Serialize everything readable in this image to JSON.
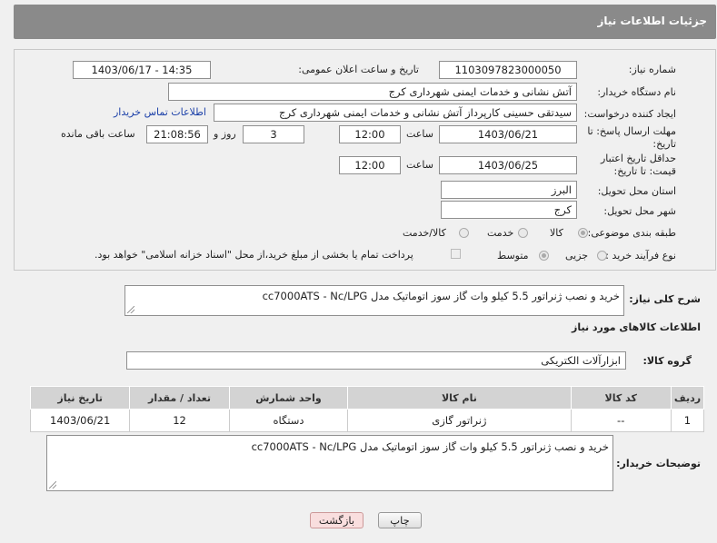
{
  "header": {
    "title": "جزئیات اطلاعات نیاز"
  },
  "form": {
    "need_number_label": "شماره نیاز:",
    "need_number": "1103097823000050",
    "announce_label": "تاریخ و ساعت اعلان عمومی:",
    "announce_value": "1403/06/17 - 14:35",
    "buyer_org_label": "نام دستگاه خریدار:",
    "buyer_org": "آتش نشانی و خدمات ایمنی شهرداری کرج",
    "requester_label": "ایجاد کننده درخواست:",
    "requester": "سیدتقی حسینی کارپرداز آتش نشانی و خدمات ایمنی شهرداری کرج",
    "contact_link": "اطلاعات تماس خریدار",
    "deadline_label": "مهلت ارسال پاسخ: تا تاریخ:",
    "deadline_date": "1403/06/21",
    "time_label": "ساعت",
    "deadline_time": "12:00",
    "days_value": "3",
    "days_label": "روز و",
    "remaining_time": "21:08:56",
    "remaining_label": "ساعت باقی مانده",
    "validity_label": "حداقل تاریخ اعتبار قیمت: تا تاریخ:",
    "validity_date": "1403/06/25",
    "validity_time": "12:00",
    "province_label": "استان محل تحویل:",
    "province": "البرز",
    "city_label": "شهر محل تحویل:",
    "city": "کرج",
    "category_label": "طبقه بندی موضوعی:",
    "category_options": [
      "کالا",
      "خدمت",
      "کالا/خدمت"
    ],
    "category_selected": "کالا",
    "process_label": "نوع فرآیند خرید :",
    "process_options": [
      "جزیی",
      "متوسط"
    ],
    "process_selected": "متوسط",
    "payment_note": "پرداخت تمام یا بخشی از مبلغ خرید،از محل \"اسناد خزانه اسلامی\" خواهد بود."
  },
  "summary": {
    "label": "شرح کلی نیاز:",
    "value": "خرید و نصب ژنراتور 5.5 کیلو وات گاز سوز اتوماتیک مدل cc7000ATS - Nc/LPG"
  },
  "goods": {
    "section_title": "اطلاعات کالاهای مورد نیاز",
    "group_label": "گروه کالا:",
    "group_value": "ابزارآلات الکتریکی",
    "columns": [
      "ردیف",
      "کد کالا",
      "نام کالا",
      "واحد شمارش",
      "تعداد / مقدار",
      "تاریخ نیاز"
    ],
    "rows": [
      {
        "row": "1",
        "code": "--",
        "name": "ژنراتور گازی",
        "unit": "دستگاه",
        "qty": "12",
        "date": "1403/06/21"
      }
    ]
  },
  "buyer_notes": {
    "label": "توضیحات خریدار:",
    "value": "خرید و نصب ژنراتور 5.5 کیلو وات گاز سوز اتوماتیک مدل cc7000ATS - Nc/LPG"
  },
  "buttons": {
    "print": "چاپ",
    "back": "بازگشت"
  },
  "colors": {
    "header_bg": "#8a8a8a",
    "link": "#1a3fa8",
    "back_button_bg": "#f9dede"
  }
}
